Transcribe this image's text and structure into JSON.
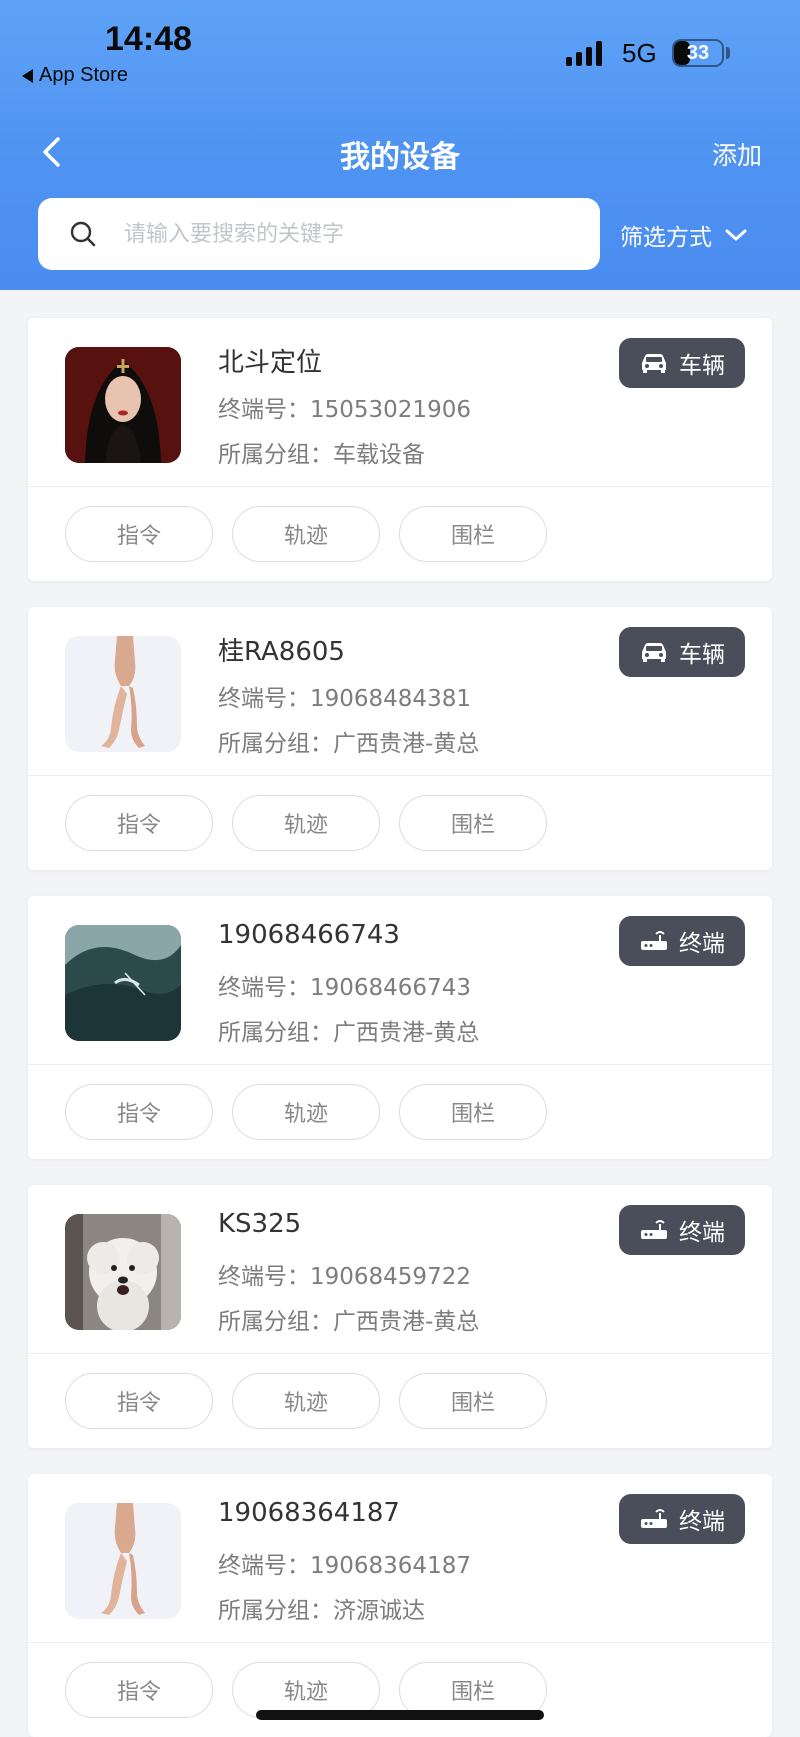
{
  "status_bar": {
    "time": "14:48",
    "back_app": "App Store",
    "network": "5G",
    "battery": "33",
    "battery_level": 0.33
  },
  "nav": {
    "title": "我的设备",
    "add_label": "添加",
    "back_icon": "chevron-left-icon"
  },
  "search": {
    "placeholder": "请输入要搜索的关键字",
    "value": ""
  },
  "filter": {
    "label": "筛选方式"
  },
  "devices": [
    {
      "name": "北斗定位",
      "terminal_label": "终端号：",
      "terminal": "15053021906",
      "group_label": "所属分组：",
      "group": "车载设备",
      "type": "车辆",
      "type_icon": "car-icon",
      "thumb": "portrait"
    },
    {
      "name": "桂RA8605",
      "terminal_label": "终端号：",
      "terminal": "19068484381",
      "group_label": "所属分组：",
      "group": "广西贵港-黄总",
      "type": "车辆",
      "type_icon": "car-icon",
      "thumb": "hand"
    },
    {
      "name": "19068466743",
      "terminal_label": "终端号：",
      "terminal": "19068466743",
      "group_label": "所属分组：",
      "group": "广西贵港-黄总",
      "type": "终端",
      "type_icon": "router-icon",
      "thumb": "wave"
    },
    {
      "name": "KS325",
      "terminal_label": "终端号：",
      "terminal": "19068459722",
      "group_label": "所属分组：",
      "group": "广西贵港-黄总",
      "type": "终端",
      "type_icon": "router-icon",
      "thumb": "dog"
    },
    {
      "name": "19068364187",
      "terminal_label": "终端号：",
      "terminal": "19068364187",
      "group_label": "所属分组：",
      "group": "济源诚达",
      "type": "终端",
      "type_icon": "router-icon",
      "thumb": "hand"
    }
  ],
  "actions": [
    "指令",
    "轨迹",
    "围栏"
  ],
  "colors": {
    "header_blue": "#4f93f2",
    "badge_bg": "#4a4e5a",
    "page_bg": "#f3f4f6"
  }
}
